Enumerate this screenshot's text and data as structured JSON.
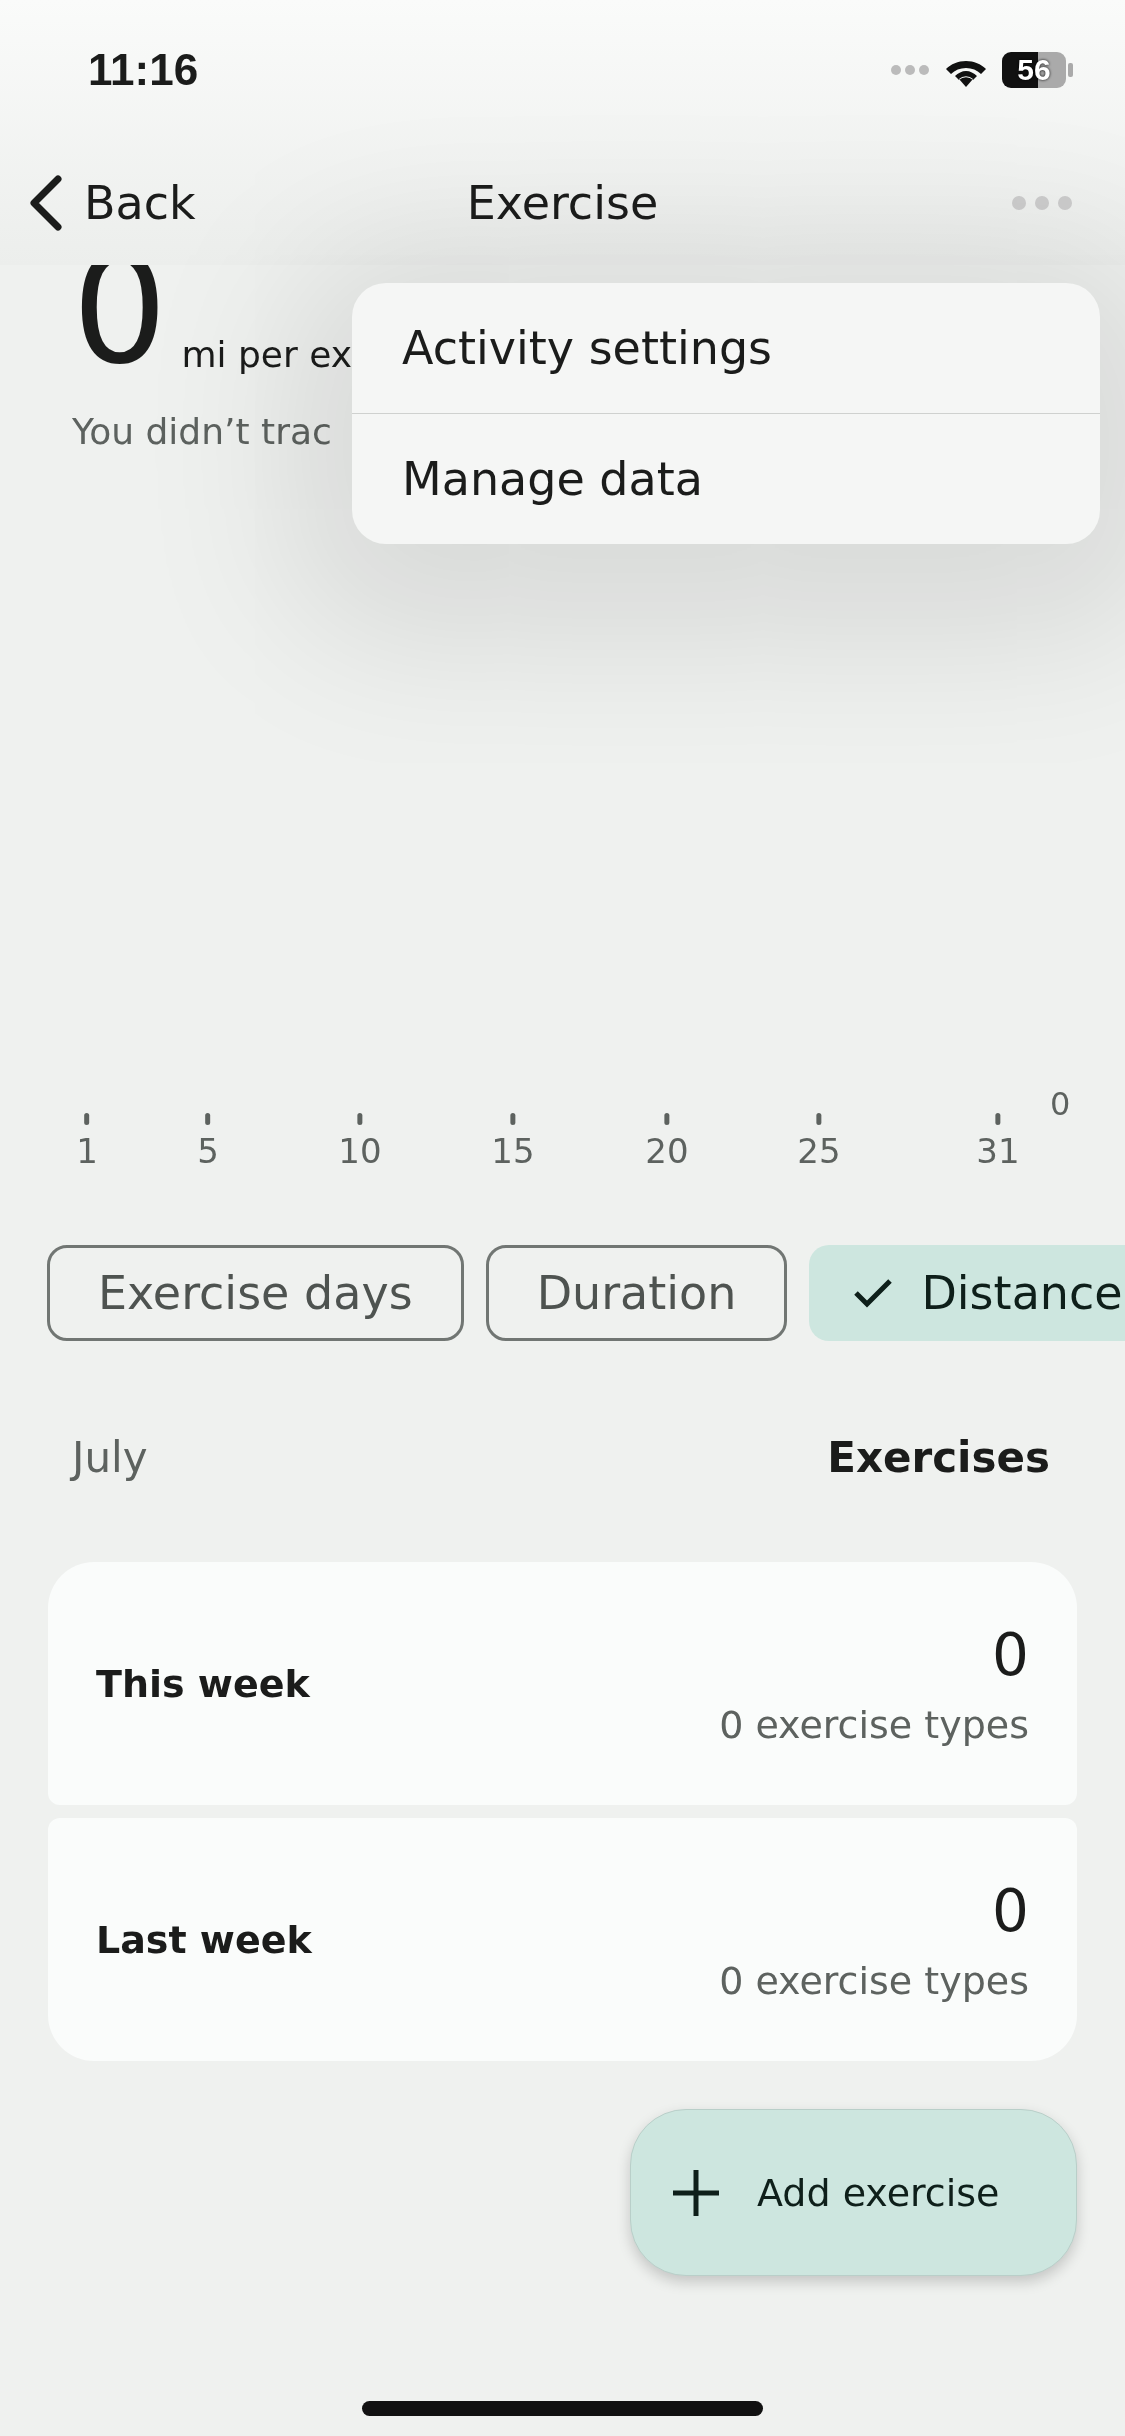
{
  "status_bar": {
    "time": "11:16",
    "battery": "56"
  },
  "nav": {
    "back": "Back",
    "title": "Exercise"
  },
  "summary": {
    "value": "0",
    "unit": "mi per ex",
    "note": "You didn’t trac"
  },
  "menu": {
    "items": [
      {
        "label": "Activity settings"
      },
      {
        "label": "Manage data"
      }
    ]
  },
  "chart": {
    "x_labels": [
      "1",
      "5",
      "10",
      "15",
      "20",
      "25",
      "31"
    ],
    "y_label": "0"
  },
  "chips": [
    {
      "label": "Exercise days",
      "selected": false
    },
    {
      "label": "Duration",
      "selected": false
    },
    {
      "label": "Distance",
      "selected": true
    }
  ],
  "section": {
    "month": "July",
    "column": "Exercises"
  },
  "cards": [
    {
      "label": "This week",
      "count": "0",
      "types": "0 exercise types"
    },
    {
      "label": "Last week",
      "count": "0",
      "types": "0 exercise types"
    }
  ],
  "fab": {
    "label": "Add exercise"
  }
}
